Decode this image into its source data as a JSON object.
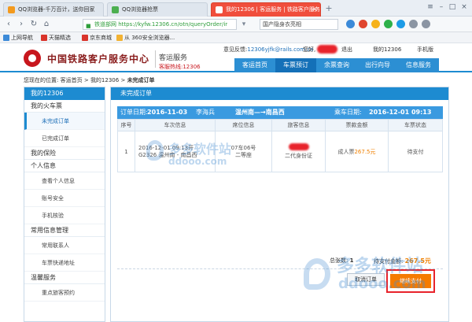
{
  "browser": {
    "tabs": [
      {
        "label": "QQ浏览器-千万百计，送你回家",
        "icon_color": "#f39a1e"
      },
      {
        "label": "QQ浏览器抢票",
        "icon_color": "#4caf50"
      },
      {
        "label": "我的12306 | 客运服务 | 铁路客户服务",
        "icon_color": "#ffffff",
        "active": true
      }
    ],
    "window_controls": [
      "≡",
      "–",
      "□",
      "×"
    ],
    "address": {
      "security_label": "铁道部网",
      "url": "https://kyfw.12306.cn/otn/queryOrder/ir"
    },
    "search_text": "国产隐身衣亮相",
    "bookmarks": [
      "上网导航",
      "天猫精选",
      "京东商城",
      "从 360安全浏览器..."
    ]
  },
  "site": {
    "brand": "中国铁路客户服务中心",
    "sub": "客运服务",
    "hotline": "客服热线:12306",
    "feedback_label": "意见反馈:",
    "feedback_email": "12306yjfk@rails.com.cn",
    "greeting": "您好,",
    "logout": "退出",
    "my_account": "我的12306",
    "mobile": "手机版",
    "nav": [
      "客运首页",
      "车票预订",
      "余票查询",
      "出行向导",
      "信息服务"
    ]
  },
  "breadcrumb": {
    "prefix": "您现在的位置:",
    "parts": [
      "客运首页",
      "我的12306"
    ],
    "current": "未完成订单",
    "sep": ">"
  },
  "sidebar": {
    "title": "我的12306",
    "sections": [
      {
        "label": "我的火车票",
        "items": [
          {
            "label": "未完成订单",
            "current": true
          },
          {
            "label": "已完成订单"
          }
        ]
      },
      {
        "label": "我的保险",
        "items": []
      },
      {
        "label": "个人信息",
        "items": [
          {
            "label": "查看个人信息"
          },
          {
            "label": "账号安全"
          },
          {
            "label": "手机核验"
          }
        ]
      },
      {
        "label": "常用信息管理",
        "items": [
          {
            "label": "常用联系人"
          },
          {
            "label": "车票快递地址"
          }
        ]
      },
      {
        "label": "温馨服务",
        "items": [
          {
            "label": "重点旅客预约"
          }
        ]
      }
    ]
  },
  "order": {
    "panel_title": "未完成订单",
    "order_date_label": "订单日期:",
    "order_date": "2016-11-03",
    "booker": "李海兵",
    "route": "温州南—→南昌西",
    "departure_label": "乘车日期:",
    "departure": "2016-12-01 09:13",
    "columns": [
      "序号",
      "车次信息",
      "席位信息",
      "旅客信息",
      "票款金额",
      "车票状态"
    ],
    "rows": [
      {
        "index": "1",
        "train_lines": [
          "2016-12-01 09:13开",
          "G2326 温州南 - 南昌西"
        ],
        "seat_lines": [
          "07车06号",
          "二等座"
        ],
        "passenger_id": "二代身份证",
        "fare_type": "成人票",
        "fare": "267.5元",
        "status": "待支付"
      }
    ],
    "total_label": "总张数:",
    "total_count": "1",
    "pending_label": "待支付金额:",
    "pending_amount": "267.5元",
    "cancel_label": "取消订单",
    "pay_label": "继续支付"
  },
  "watermark": {
    "text_cn": "多多软件站",
    "text_en": "ddooo.com"
  }
}
